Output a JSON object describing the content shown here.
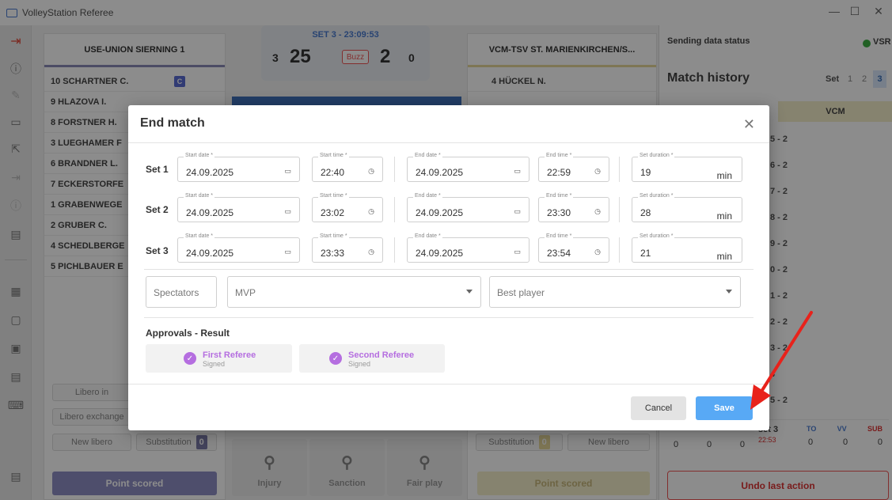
{
  "window": {
    "title": "VolleyStation Referee",
    "minimize": "—",
    "maximize": "☐",
    "close": "✕"
  },
  "left_team": {
    "name": "USE-UNION SIERNING 1",
    "players": [
      {
        "label": "10 SCHARTNER C.",
        "captain": "C"
      },
      {
        "label": "9 HLAZOVA I."
      },
      {
        "label": "8 FORSTNER H."
      },
      {
        "label": "3 LUEGHAMER F"
      },
      {
        "label": "6 BRANDNER L."
      },
      {
        "label": "7 ECKERSTORFE"
      },
      {
        "label": "1 GRABENWEGE"
      },
      {
        "label": "2 GRUBER C."
      },
      {
        "label": "4 SCHEDLBERGE"
      },
      {
        "label": "5 PICHLBAUER E"
      }
    ],
    "libero_in": "Libero in",
    "libero_exchange": "Libero exchange",
    "new_libero": "New libero",
    "substitution": "Substitution",
    "substitution_count": "0",
    "point_scored": "Point scored"
  },
  "score": {
    "set_label": "SET 3 - 23:09:53",
    "left_sets": "3",
    "left_points": "25",
    "buzz": "Buzz",
    "right_points": "2",
    "right_sets": "0"
  },
  "center_actions": {
    "injury": "Injury",
    "sanction": "Sanction",
    "fair_play": "Fair play"
  },
  "right_team": {
    "name": "VCM-TSV ST. MARIENKIRCHEN/S...",
    "players": [
      {
        "label": "4 HÜCKEL N."
      }
    ],
    "substitution": "Substitution",
    "substitution_count": "0",
    "new_libero": "New libero",
    "point_scored": "Point scored"
  },
  "history": {
    "sending_status": "Sending data status",
    "vsr": "VSR",
    "title": "Match history",
    "set_label": "Set",
    "sets": [
      "1",
      "2",
      "3"
    ],
    "team_header": "VCM",
    "rows": [
      "5 - 2",
      "6 - 2",
      "7 - 2",
      "8 - 2",
      "9 - 2",
      "0 - 2",
      "1 - 2",
      "2 - 2",
      "3 - 2",
      "4",
      "5 - 2"
    ],
    "footer_set": "set 3",
    "footer_time": "22:53",
    "footer_left_vals": [
      "0",
      "0",
      "0"
    ],
    "footer_heads": [
      "TO",
      "VV",
      "SUB"
    ],
    "footer_right_vals": [
      "0",
      "0",
      "0"
    ],
    "undo": "Undo last action"
  },
  "dialog": {
    "title": "End match",
    "close": "✕",
    "labels": {
      "start_date": "Start date *",
      "start_time": "Start time *",
      "end_date": "End date *",
      "end_time": "End time *",
      "set_duration": "Set duration *"
    },
    "duration_unit": "min",
    "sets": [
      {
        "label": "Set 1",
        "start_date": "24.09.2025",
        "start_time": "22:40",
        "end_date": "24.09.2025",
        "end_time": "22:59",
        "duration": "19"
      },
      {
        "label": "Set 2",
        "start_date": "24.09.2025",
        "start_time": "23:02",
        "end_date": "24.09.2025",
        "end_time": "23:30",
        "duration": "28"
      },
      {
        "label": "Set 3",
        "start_date": "24.09.2025",
        "start_time": "23:33",
        "end_date": "24.09.2025",
        "end_time": "23:54",
        "duration": "21"
      }
    ],
    "spectators": "Spectators",
    "mvp": "MVP",
    "best_player": "Best player",
    "approvals_title": "Approvals - Result",
    "approvals": [
      {
        "name": "First Referee",
        "status": "Signed"
      },
      {
        "name": "Second Referee",
        "status": "Signed"
      }
    ],
    "cancel": "Cancel",
    "save": "Save"
  },
  "colors": {
    "accent_blue": "#58a9f5",
    "left_team": "#8e8ec5",
    "right_team": "#e6d89a",
    "signed": "#b56ee0",
    "annotation_arrow": "#e8221b"
  }
}
